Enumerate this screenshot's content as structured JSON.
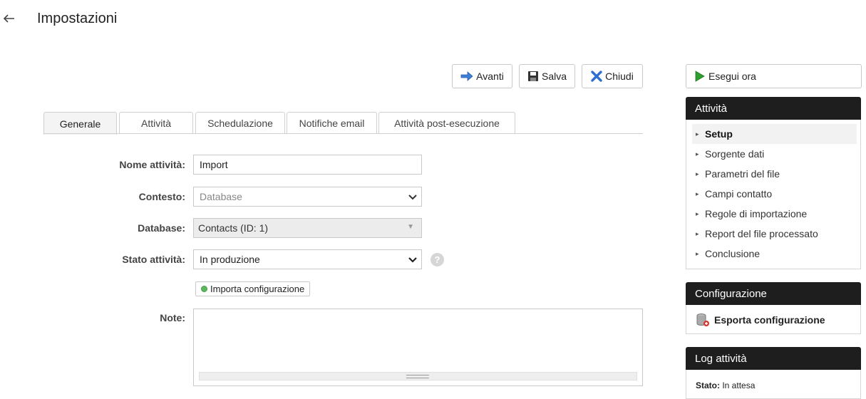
{
  "header": {
    "title": "Impostazioni",
    "back_icon": "arrow-left-icon"
  },
  "toolbar": {
    "next_label": "Avanti",
    "save_label": "Salva",
    "close_label": "Chiudi"
  },
  "tabs": [
    {
      "label": "Generale",
      "active": true
    },
    {
      "label": "Attività"
    },
    {
      "label": "Schedulazione"
    },
    {
      "label": "Notifiche email"
    },
    {
      "label": "Attività post-esecuzione"
    }
  ],
  "form": {
    "name_label": "Nome attività:",
    "name_value": "Import",
    "context_label": "Contesto:",
    "context_value": "Database",
    "database_label": "Database:",
    "database_value": "Contacts (ID: 1)",
    "status_label": "Stato attività:",
    "status_value": "In produzione",
    "import_config_label": "Importa configurazione",
    "notes_label": "Note:",
    "notes_value": ""
  },
  "sidebar": {
    "run_now_label": "Esegui ora",
    "activity_title": "Attività",
    "items": [
      {
        "label": "Setup",
        "active": true
      },
      {
        "label": "Sorgente dati"
      },
      {
        "label": "Parametri del file"
      },
      {
        "label": "Campi contatto"
      },
      {
        "label": "Regole di importazione"
      },
      {
        "label": "Report del file processato"
      },
      {
        "label": "Conclusione"
      }
    ],
    "config_title": "Configurazione",
    "export_config_label": "Esporta configurazione",
    "log_title": "Log attività",
    "log_status_label": "Stato:",
    "log_status_value": "In attesa"
  },
  "colors": {
    "panel_header": "#1e1e1e",
    "active_tab": "#f4f4f4",
    "run_icon": "#2e9e2e"
  }
}
